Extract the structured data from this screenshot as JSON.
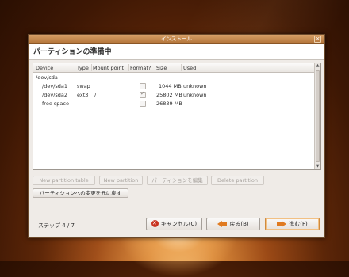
{
  "window": {
    "title": "インストール",
    "close_glyph": "×",
    "page_heading": "パーティションの準備中"
  },
  "table": {
    "columns": [
      "Device",
      "Type",
      "Mount point",
      "Format?",
      "Size",
      "Used"
    ],
    "rows": [
      {
        "device": "/dev/sda",
        "type": "",
        "mount": "",
        "format": null,
        "size": "",
        "used": ""
      },
      {
        "device": "/dev/sda1",
        "type": "swap",
        "mount": "",
        "format": false,
        "size": "1044 MB",
        "used": "unknown"
      },
      {
        "device": "/dev/sda2",
        "type": "ext3",
        "mount": "/",
        "format": true,
        "size": "25802 MB",
        "used": "unknown"
      },
      {
        "device": "free space",
        "type": "",
        "mount": "",
        "format": false,
        "size": "26839 MB",
        "used": ""
      }
    ]
  },
  "partition_buttons": {
    "new_table": "New partition table",
    "new_partition": "New partition",
    "edit": "パーティションを編集",
    "delete": "Delete partition"
  },
  "revert_button": "パーティションへの変更を元に戻す",
  "footer": {
    "step_label": "ステップ 4 / 7",
    "cancel": "キャンセル(C)",
    "back": "戻る(B)",
    "forward": "進む(F)"
  },
  "icons": {
    "cancel": "cancel-icon",
    "back": "back-arrow-icon",
    "forward": "forward-arrow-icon"
  },
  "colors": {
    "accent": "#e07a20",
    "titlebar": "#c48a50",
    "cancel_red": "#c8321f"
  }
}
